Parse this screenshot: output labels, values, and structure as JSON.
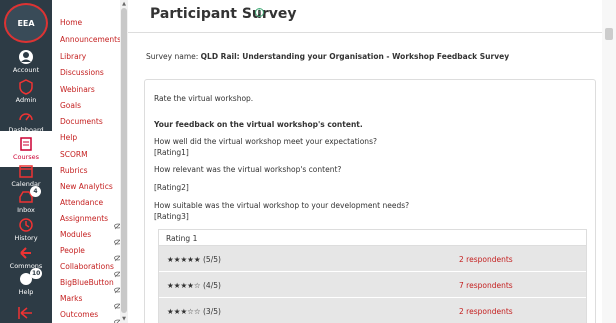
{
  "global_nav": {
    "logo_text": "EEA",
    "items": [
      {
        "label": "Account",
        "icon": "account-icon"
      },
      {
        "label": "Admin",
        "icon": "admin-icon"
      },
      {
        "label": "Dashboard",
        "icon": "dashboard-icon"
      },
      {
        "label": "Courses",
        "icon": "courses-icon"
      },
      {
        "label": "Calendar",
        "icon": "calendar-icon"
      },
      {
        "label": "Inbox",
        "icon": "inbox-icon",
        "badge": "4"
      },
      {
        "label": "History",
        "icon": "history-icon"
      },
      {
        "label": "Commons",
        "icon": "commons-icon"
      },
      {
        "label": "Help",
        "icon": "help-icon",
        "badge": "10"
      }
    ],
    "collapse_icon": "collapse-arrow-icon",
    "active_item": "Courses",
    "active_color": "#c03"
  },
  "course_nav": {
    "items": [
      "Home",
      "Announcements",
      "Library",
      "Discussions",
      "Webinars",
      "Goals",
      "Documents",
      "Help",
      "SCORM",
      "Rubrics",
      "New Analytics",
      "Attendance",
      "Assignments",
      "Modules",
      "People",
      "Collaborations",
      "BigBlueButton",
      "Marks",
      "Outcomes"
    ],
    "link_color": "#c41f1f"
  },
  "main": {
    "title": "Participant Survey",
    "survey_name_label": "Survey name:",
    "survey_name_value": "QLD Rail: Understanding your Organisation - Workshop Feedback Survey",
    "intro": "Rate the virtual workshop.",
    "section_heading": "Your feedback on the virtual workshop's content.",
    "questions": [
      {
        "text": "How well did the virtual workshop meet your expectations?",
        "tag": "[Rating1]"
      },
      {
        "text": "How relevant was the virtual workshop's content?",
        "tag": "[Rating2]"
      },
      {
        "text": "How suitable was the virtual workshop to your development needs?",
        "tag": "[Rating3]"
      }
    ],
    "results_table": {
      "header": "Rating 1",
      "rows": [
        {
          "stars": "★★★★★ (5/5)",
          "respondents": "2 respondents"
        },
        {
          "stars": "★★★★☆ (4/5)",
          "respondents": "7 respondents"
        },
        {
          "stars": "★★★☆☆ (3/5)",
          "respondents": "2 respondents"
        }
      ]
    }
  }
}
